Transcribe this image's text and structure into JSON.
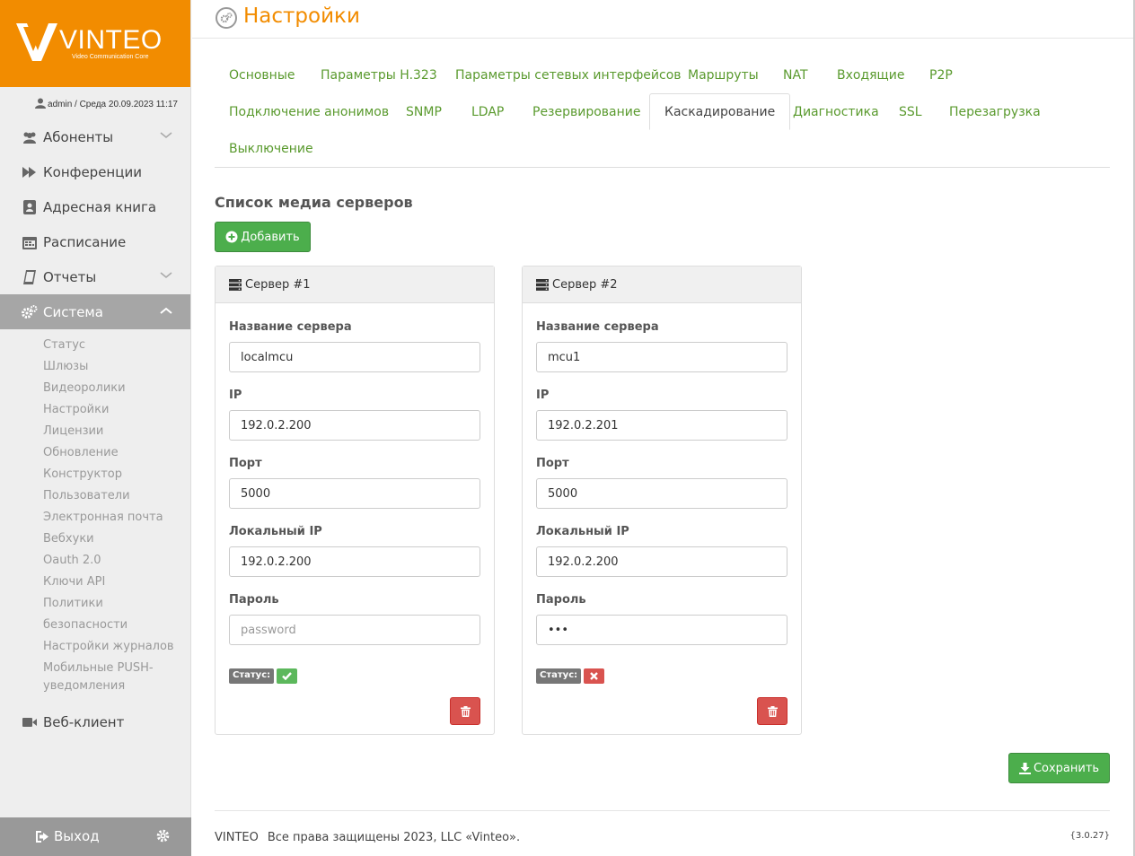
{
  "logo": {
    "brand": "VINTEO",
    "tagline": "Video Communication Core"
  },
  "user": {
    "text": "admin / Среда 20.09.2023 11:17"
  },
  "nav": {
    "items": [
      {
        "label": "Абоненты"
      },
      {
        "label": "Конференции"
      },
      {
        "label": "Адресная книга"
      },
      {
        "label": "Расписание"
      },
      {
        "label": "Отчеты"
      },
      {
        "label": "Система"
      }
    ],
    "sub_items": [
      "Статус",
      "Шлюзы",
      "Видеоролики",
      "Настройки",
      "Лицензии",
      "Обновление",
      "Конструктор",
      "Пользователи",
      "Электронная почта",
      "Вебхуки",
      "Oauth 2.0",
      "Ключи API",
      "Политики безопасности",
      "Настройки журналов"
    ],
    "sub_multiline": {
      "line1": "Мобильные PUSH-",
      "line2": "уведомления"
    },
    "web_client": "Веб-клиент",
    "logout": "Выход"
  },
  "page": {
    "title": "Настройки"
  },
  "tabs": [
    "Основные",
    "Параметры H.323",
    "Параметры сетевых интерфейсов",
    "Маршруты",
    "NAT",
    "Входящие",
    "P2P",
    "Подключение анонимов",
    "SNMP",
    "LDAP",
    "Резервирование",
    "Каскадирование",
    "Диагностика",
    "SSL",
    "Перезагрузка",
    "Выключение"
  ],
  "active_tab": "Каскадирование",
  "section": {
    "title": "Список медиа серверов",
    "add_label": "Добавить"
  },
  "servers": [
    {
      "title": "Сервер #1",
      "labels": {
        "name": "Название сервера",
        "ip": "IP",
        "port": "Порт",
        "local_ip": "Локальный IP",
        "password": "Пароль"
      },
      "values": {
        "name": "localmcu",
        "ip": "192.0.2.200",
        "port": "5000",
        "local_ip": "192.0.2.200",
        "password": ""
      },
      "password_placeholder": "password",
      "status_label": "Статус:",
      "status": "ok"
    },
    {
      "title": "Сервер #2",
      "labels": {
        "name": "Название сервера",
        "ip": "IP",
        "port": "Порт",
        "local_ip": "Локальный IP",
        "password": "Пароль"
      },
      "values": {
        "name": "mcu1",
        "ip": "192.0.2.201",
        "port": "5000",
        "local_ip": "192.0.2.200",
        "password": "•••"
      },
      "password_placeholder": "",
      "status_label": "Статус:",
      "status": "error"
    }
  ],
  "save_label": "Сохранить",
  "footer": {
    "brand": "VINTEO",
    "copyright": "Все права защищены 2023, LLC «Vinteo».",
    "version": "{3.0.27}"
  },
  "colors": {
    "accent": "#f28c00",
    "success": "#4cae4c",
    "danger": "#d9534f",
    "link": "#5a9a2e"
  }
}
